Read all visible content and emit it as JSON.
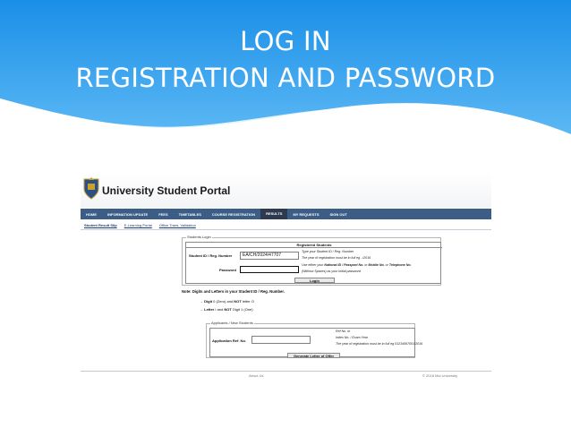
{
  "slide": {
    "title_line1": "LOG IN",
    "title_line2": "REGISTRATION AND PASSWORD",
    "header_colors": {
      "top": "#1a8fe8",
      "bottom": "#55b4f2",
      "wave": "#ffffff"
    }
  },
  "portal": {
    "name": "University Student Portal",
    "nav": [
      "HOME",
      "INFORMATION UPDATE",
      "FEES",
      "TIMETABLES",
      "COURSE REGISTRATION",
      "RESULTS",
      "MY REQUESTS",
      "SIGN OUT"
    ],
    "nav_active": "RESULTS",
    "subnav": [
      "Student Result Slip",
      "E-Learning Portal",
      "Office Trans. Validation"
    ],
    "nav_color": "#3c5d86"
  },
  "students_login": {
    "legend": "Students Login",
    "heading": "Registered Students",
    "student_id_label": "Student ID / Reg. Number",
    "student_id_value": "EA/CH/2024/47707",
    "student_id_hint1": "Type your Student ID / Reg. Number",
    "student_id_hint2": "The year of registration must be in full eg ../2016",
    "password_label": "Password",
    "password_value": "",
    "password_hint1_pre": "Use either your ",
    "password_hint1_bold": "National ID / Passport No.",
    "password_hint1_mid": " or ",
    "password_hint1_bold2": "Mobile No.",
    "password_hint1_or": " or ",
    "password_hint1_bold3": "Telephone No.",
    "password_hint2": "(Without Spaces) as your initial password",
    "login_button": "Login"
  },
  "note": {
    "text": "Note: Digits and Letters in your Student ID / Reg. Number.",
    "bullet1_bold": "Digit",
    "bullet1_rest": " 0 (Zero) and ",
    "bullet1_bold2": "NOT",
    "bullet1_end": " letter O",
    "bullet2_bold": "Letter",
    "bullet2_rest": " I and ",
    "bullet2_bold2": "NOT",
    "bullet2_end": " Digit 1 (One)"
  },
  "applicants": {
    "legend": "Applicants / New Students",
    "ref_label": "Application Ref. No.",
    "ref_value": "",
    "hint1": "Ref No. or",
    "hint2": "Index No. / Exam Year",
    "hint3": "The year of registration must be in full eg 01234567001/2016",
    "generate_button": "Generate Letter of Offer"
  },
  "footer": {
    "left": "About Us",
    "right": "© 2016 Moi University"
  }
}
